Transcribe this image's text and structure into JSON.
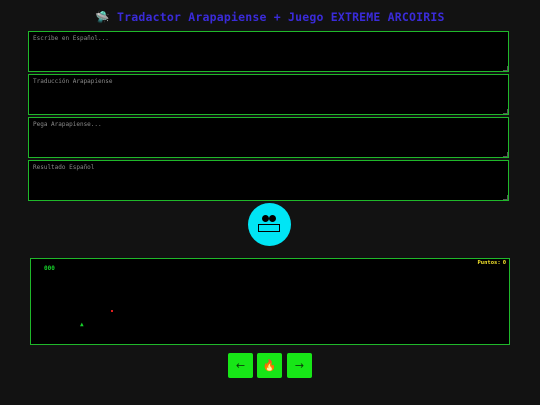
{
  "header": {
    "icon": "satellite-icon",
    "icon_glyph": "🛸",
    "title": "Tradactor Arapapiense + Juego EXTREME ARCOIRIS"
  },
  "translator": {
    "spanish_input_placeholder": "Escribe en Español...",
    "arapapiense_output_placeholder": "Traducción Arapapiense",
    "arapapiense_input_placeholder": "Pega Arapapiense...",
    "spanish_output_placeholder": "Resultado Español"
  },
  "mascot": {
    "icon": "robot-face-icon",
    "color": "#00e5f5"
  },
  "game": {
    "score_label": "Puntos:",
    "score": 0,
    "invader_glyph": "000",
    "player_glyph": "▲",
    "colors": {
      "border": "#1fb82a",
      "score": "#f3e22b",
      "invader": "#16d12a",
      "bullet": "#e11f1f"
    }
  },
  "controls": {
    "left_label": "←",
    "fire_label": "🔥",
    "right_label": "→",
    "color": "#17e617"
  }
}
